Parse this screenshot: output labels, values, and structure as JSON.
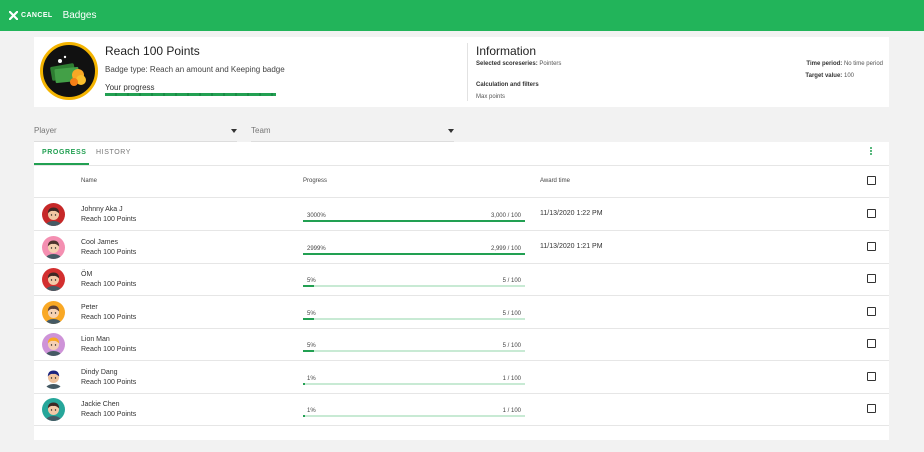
{
  "topbar": {
    "cancel_label": "CANCEL",
    "title": "Badges"
  },
  "badge": {
    "title": "Reach 100 Points",
    "type": "Badge type: Reach an amount and Keeping badge",
    "progress_label": "Your progress",
    "progress": 1.0
  },
  "info": {
    "title": "Information",
    "scoreseries_label": "Selected scoreseries:",
    "scoreseries_value": "Pointers",
    "calc_label": "Calculation and filters",
    "calc_value": "Max points",
    "time_label": "Time period:",
    "time_value": "No time period",
    "target_label": "Target value:",
    "target_value": "100"
  },
  "filters": {
    "player": "Player",
    "team": "Team"
  },
  "tabs": {
    "progress": "PROGRESS",
    "history": "HISTORY"
  },
  "columns": {
    "name": "Name",
    "progress": "Progress",
    "award": "Award time"
  },
  "rows": [
    {
      "name": "Johnny Aka J",
      "badge": "Reach 100 Points",
      "pct": "3000%",
      "count": "3,000 / 100",
      "progress": 1.0,
      "award": "11/13/2020 1:22 PM",
      "avatar": "male-avatar-red"
    },
    {
      "name": "Cool James",
      "badge": "Reach 100 Points",
      "pct": "2999%",
      "count": "2,999 / 100",
      "progress": 1.0,
      "award": "11/13/2020 1:21 PM",
      "avatar": "male-avatar-pink"
    },
    {
      "name": "ÖM",
      "badge": "Reach 100 Points",
      "pct": "5%",
      "count": "5 / 100",
      "progress": 0.05,
      "award": "",
      "avatar": "female-avatar-red"
    },
    {
      "name": "Peter",
      "badge": "Reach 100 Points",
      "pct": "5%",
      "count": "5 / 100",
      "progress": 0.05,
      "award": "",
      "avatar": "male-avatar-yellow"
    },
    {
      "name": "Lion Man",
      "badge": "Reach 100 Points",
      "pct": "5%",
      "count": "5 / 100",
      "progress": 0.05,
      "award": "",
      "avatar": "female-avatar-purple"
    },
    {
      "name": "Dindy Dang",
      "badge": "Reach 100 Points",
      "pct": "1%",
      "count": "1 / 100",
      "progress": 0.01,
      "award": "",
      "avatar": "female-avatar-dark"
    },
    {
      "name": "Jackie Chen",
      "badge": "Reach 100 Points",
      "pct": "1%",
      "count": "1 / 100",
      "progress": 0.01,
      "award": "",
      "avatar": "male-avatar-teal"
    }
  ],
  "colors": {
    "brand": "#22b45a",
    "accent": "#22a052",
    "badge_ring": "#f4b400"
  }
}
